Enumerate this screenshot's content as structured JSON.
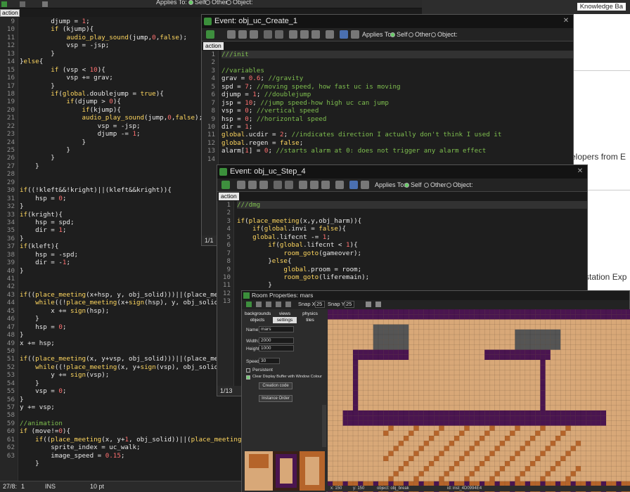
{
  "main_editor": {
    "tab_label": "action",
    "toolbar_options": [
      "Applies To:",
      "Self",
      "Other",
      "Object:"
    ],
    "line_numbers": [
      "9",
      "10",
      "11",
      "12",
      "13",
      "14",
      "15",
      "16",
      "17",
      "18",
      "19",
      "20",
      "21",
      "22",
      "23",
      "24",
      "25",
      "26",
      "27",
      "28",
      "29",
      "30",
      "31",
      "32",
      "33",
      "34",
      "35",
      "36",
      "37",
      "38",
      "39",
      "40",
      "41",
      "42",
      "43",
      "44",
      "45",
      "46",
      "47",
      "48",
      "49",
      "50",
      "51",
      "52",
      "53",
      "54",
      "55",
      "56",
      "57",
      "58",
      "59",
      "60",
      "61",
      "62",
      "63"
    ],
    "lines": [
      "        djump = 1;",
      "        if (kjump){",
      "            audio_play_sound(jump,0,false);",
      "            vsp = -jsp;",
      "        }",
      "}else{",
      "        if (vsp < 10){",
      "            vsp += grav;",
      "        }",
      "        if(global.doublejump = true){",
      "            if(djump > 0){",
      "                if(kjump){",
      "                audio_play_sound(jump,0,false);",
      "                    vsp = -jsp;",
      "                    djump -= 1;",
      "                }",
      "            }",
      "        }",
      "    }",
      "",
      "",
      "if((!kleft&&!kright)||(kleft&&kright)){",
      "    hsp = 0;",
      "}",
      "if(kright){",
      "    hsp = spd;",
      "    dir = 1;",
      "}",
      "if(kleft){",
      "    hsp = -spd;",
      "    dir = -1;",
      "}",
      "",
      "",
      "if((place_meeting(x+hsp, y, obj_solid)))||(place_meet",
      "    while((!place_meeting(x+sign(hsp), y, obj_solid)",
      "        x += sign(hsp);",
      "    }",
      "    hsp = 0;",
      "}",
      "x += hsp;",
      "",
      "if((place_meeting(x, y+vsp, obj_solid)))||(place_meet",
      "    while((!place_meeting(x, y+sign(vsp), obj_solid)",
      "        y += sign(vsp);",
      "    }",
      "    vsp = 0;",
      "}",
      "y += vsp;",
      "",
      "//animation",
      "if (move!=0){",
      "    if((place_meeting(x, y+1, obj_solid))||(place_meeting(",
      "        sprite_index = uc_walk;",
      "        image_speed = 0.15;",
      "    }"
    ],
    "status": {
      "line": "1",
      "mode": "INS",
      "font_size": "10 pt"
    }
  },
  "create_window": {
    "title": "Event: obj_uc_Create_1",
    "tab_label": "action",
    "applies_to": "Applies To:",
    "opt_self": "Self",
    "opt_other": "Other",
    "opt_object": "Object:",
    "line_numbers": [
      "1",
      "2",
      "3",
      "4",
      "5",
      "6",
      "7",
      "8",
      "9",
      "10",
      "11",
      "12",
      "13",
      "14"
    ],
    "lines": [
      "///init",
      "",
      "//variables",
      "grav = 0.6; //gravity",
      "spd = 7; //moving speed, how fast uc is moving",
      "djump = 1; //doublejump",
      "jsp = 10; //jump speed-how high uc can jump",
      "vsp = 0; //vertical speed",
      "hsp = 0; //horizontal speed",
      "dir = 1;",
      "global.ucdir = 2; //indicates direction I actually don't think I used it",
      "global.regen = false;",
      "alarm[1] = 0; //starts alarm at 0: does not trigger any alarm effect",
      ""
    ],
    "status": "1/1"
  },
  "step_window": {
    "title": "Event: obj_uc_Step_4",
    "tab_label": "action",
    "applies_to": "Applies To:",
    "opt_self": "Self",
    "opt_other": "Other",
    "opt_object": "Object:",
    "line_numbers": [
      "1",
      "2",
      "3",
      "4",
      "5",
      "6",
      "7",
      "8",
      "9",
      "10",
      "11",
      "12",
      "13"
    ],
    "lines": [
      "///dmg",
      "",
      "if(place_meeting(x,y,obj_harm)){",
      "    if(global.invi = false){",
      "    global.lifecnt -= 1;",
      "        if(global.lifecnt < 1){",
      "            room_goto(gameover);",
      "        }else{",
      "            global.proom = room;",
      "            room_goto(liferemain);",
      "        }",
      "    }",
      ""
    ],
    "status": "1/13"
  },
  "room_window": {
    "title": "Room Properties: mars",
    "snap_x_label": "Snap X:",
    "snap_x": "25",
    "snap_y_label": "Snap Y:",
    "snap_y": "25",
    "tabs_row1": [
      "backgrounds",
      "views",
      "physics"
    ],
    "tabs_row2": [
      "objects",
      "settings",
      "tiles"
    ],
    "name_label": "Name:",
    "name_value": "mars",
    "width_label": "Width:",
    "width_value": "2000",
    "height_label": "Height:",
    "height_value": "1000",
    "speed_label": "Speed:",
    "speed_value": "30",
    "persistent_label": "Persistent",
    "clear_label": "Clear Display Buffer with Window Colour",
    "creation_code_btn": "Creation code",
    "instance_order_btn": "Instance Order",
    "status_x": "x: 150",
    "status_y": "y: 150",
    "status_obj": "object: obj_break",
    "status_id": "id: inst_4D0994E4"
  },
  "background_app": {
    "knowledge_base": "Knowledge Ba",
    "text1": "elopers from E",
    "text2": "station Exp"
  },
  "colors": {
    "keyword": "#ffd75f",
    "number": "#ff7070",
    "comment": "#7fbf4f",
    "text": "#e8e8e8",
    "room_purple": "#4a1550",
    "room_tan": "#d8a878",
    "room_orange": "#b5642a"
  }
}
